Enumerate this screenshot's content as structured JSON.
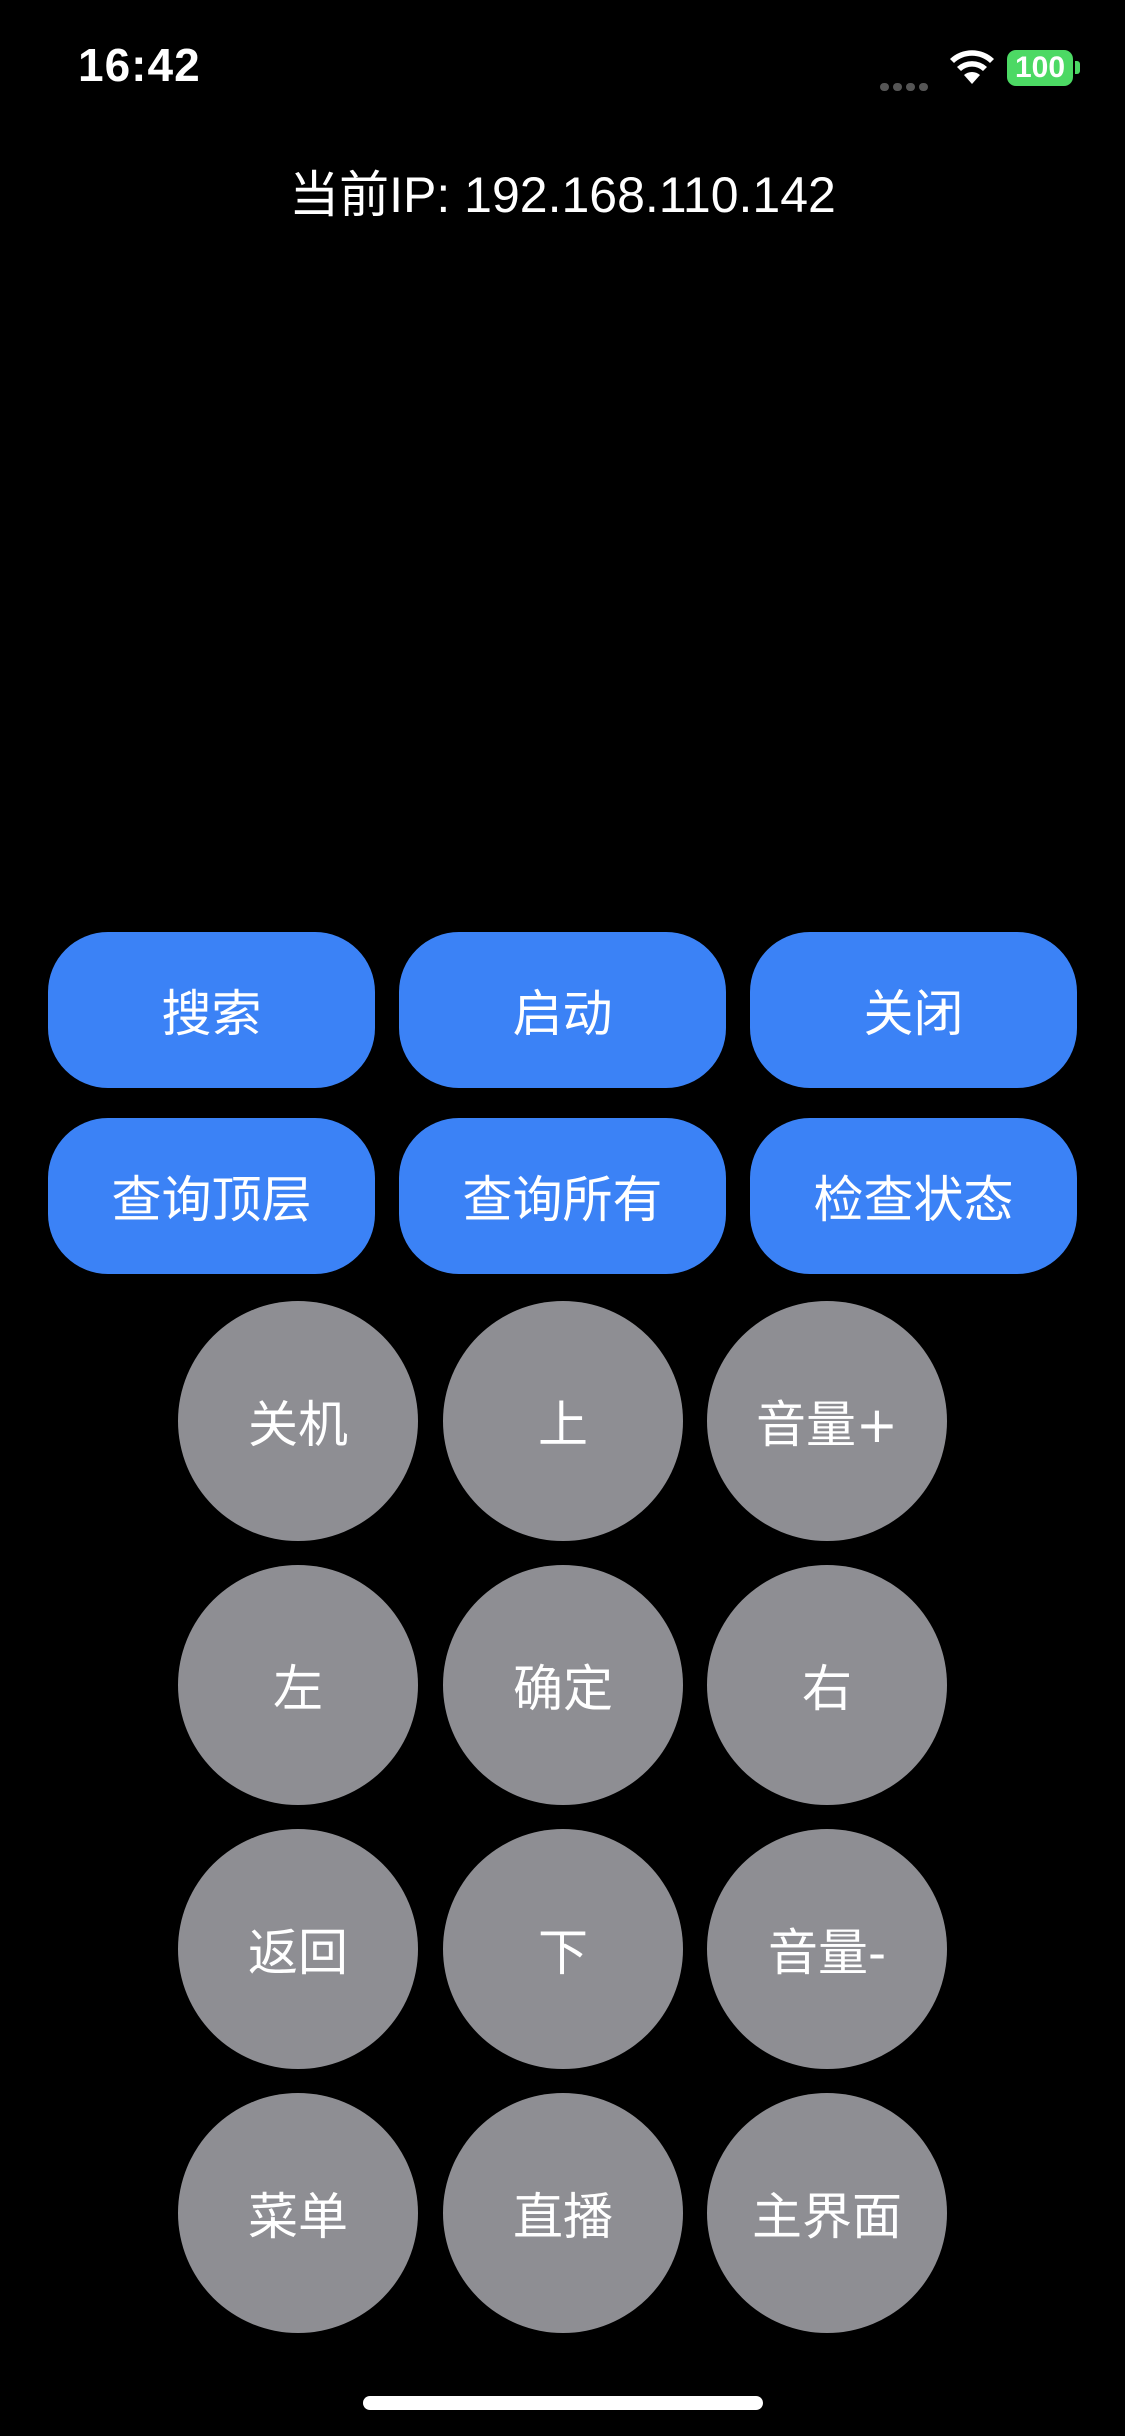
{
  "status_bar": {
    "time": "16:42",
    "battery": "100",
    "signal_icon": "cellular-signal-icon",
    "wifi_icon": "wifi-icon",
    "battery_color": "#4cd964"
  },
  "ip_text": "当前IP: 192.168.110.142",
  "colors": {
    "background": "#000000",
    "primary_button": "#3b82f6",
    "remote_button": "#8e8e93",
    "text": "#ffffff"
  },
  "action_buttons": [
    {
      "label": "搜索"
    },
    {
      "label": "启动"
    },
    {
      "label": "关闭"
    },
    {
      "label": "查询顶层"
    },
    {
      "label": "查询所有"
    },
    {
      "label": "检查状态"
    }
  ],
  "remote_buttons": [
    {
      "label": "关机"
    },
    {
      "label": "上"
    },
    {
      "label": "音量+"
    },
    {
      "label": "左"
    },
    {
      "label": "确定"
    },
    {
      "label": "右"
    },
    {
      "label": "返回"
    },
    {
      "label": "下"
    },
    {
      "label": "音量-"
    },
    {
      "label": "菜单"
    },
    {
      "label": "直播"
    },
    {
      "label": "主界面"
    }
  ]
}
